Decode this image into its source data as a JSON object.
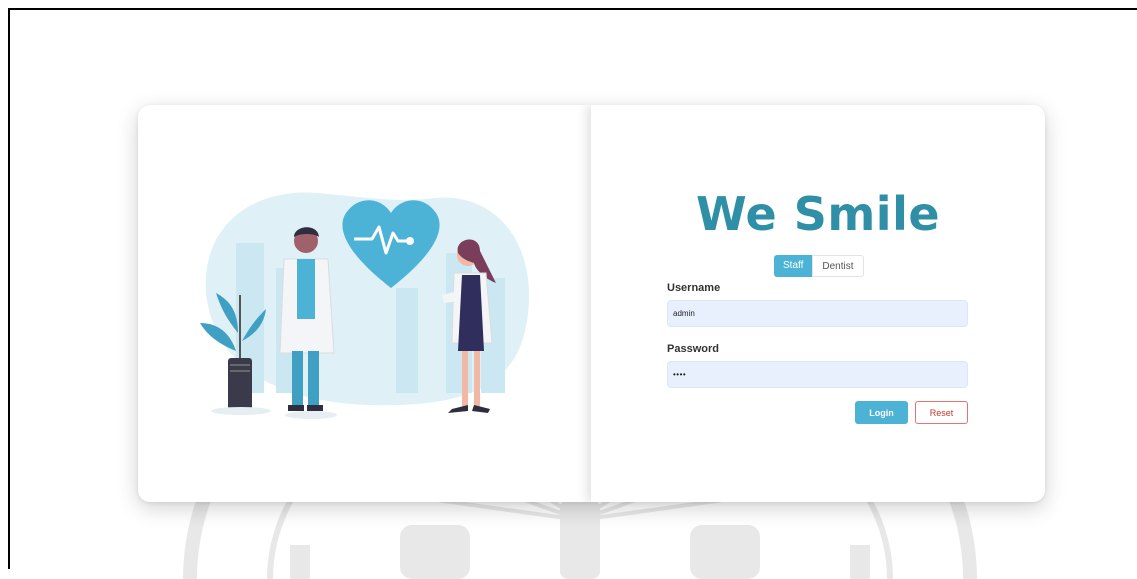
{
  "app": {
    "title": "We Smile"
  },
  "role_toggle": {
    "options": [
      "Staff",
      "Dentist"
    ],
    "selected": "Staff"
  },
  "form": {
    "username_label": "Username",
    "username_value": "admin",
    "password_label": "Password",
    "password_value": "••••"
  },
  "actions": {
    "login_label": "Login",
    "reset_label": "Reset"
  },
  "colors": {
    "brand": "#2e8fa6",
    "primary_button": "#4db3d6",
    "reset_border": "#e57373",
    "input_background": "#e8f0fe"
  },
  "illustration": {
    "icons": [
      "heart-ecg-icon",
      "doctor-man-icon",
      "doctor-woman-icon",
      "potted-plant-icon"
    ]
  }
}
